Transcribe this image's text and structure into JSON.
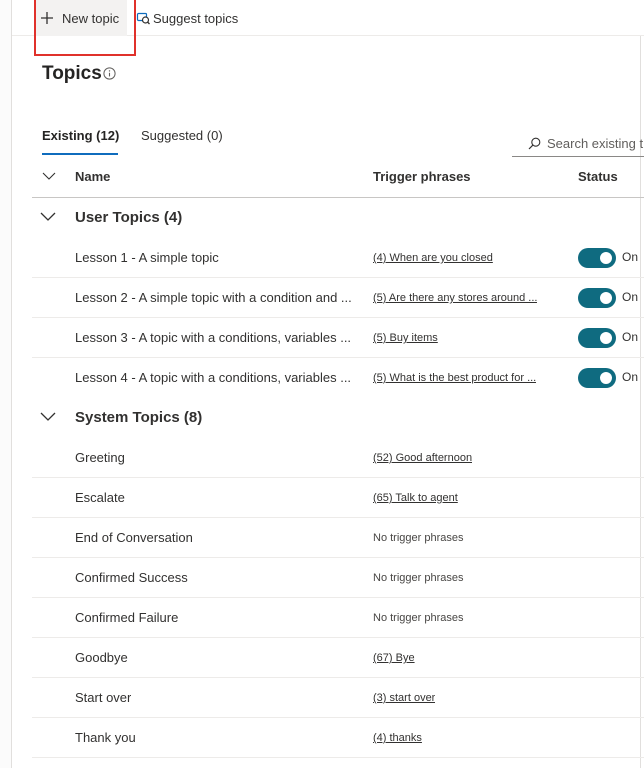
{
  "command_bar": {
    "new_topic": "New topic",
    "suggest_topics": "Suggest topics"
  },
  "page": {
    "title": "Topics"
  },
  "tabs": {
    "existing": "Existing (12)",
    "suggested": "Suggested (0)"
  },
  "search": {
    "placeholder": "Search existing t"
  },
  "table": {
    "col_name": "Name",
    "col_trigger": "Trigger phrases",
    "col_status": "Status"
  },
  "user_topics": {
    "label": "User Topics (4)",
    "rows": [
      {
        "name": "Lesson 1 - A simple topic",
        "trigger": "(4) When are you closed",
        "status": "On"
      },
      {
        "name": "Lesson 2 - A simple topic with a condition and ...",
        "trigger": "(5) Are there any stores around ...",
        "status": "On"
      },
      {
        "name": "Lesson 3 - A topic with a conditions, variables ...",
        "trigger": "(5) Buy items",
        "status": "On"
      },
      {
        "name": "Lesson 4 - A topic with a conditions, variables ...",
        "trigger": "(5) What is the best product for ...",
        "status": "On"
      }
    ]
  },
  "system_topics": {
    "label": "System Topics (8)",
    "rows": [
      {
        "name": "Greeting",
        "trigger": "(52) Good afternoon"
      },
      {
        "name": "Escalate",
        "trigger": "(65) Talk to agent"
      },
      {
        "name": "End of Conversation",
        "trigger": "No trigger phrases"
      },
      {
        "name": "Confirmed Success",
        "trigger": "No trigger phrases"
      },
      {
        "name": "Confirmed Failure",
        "trigger": "No trigger phrases"
      },
      {
        "name": "Goodbye",
        "trigger": "(67) Bye"
      },
      {
        "name": "Start over",
        "trigger": "(3) start over"
      },
      {
        "name": "Thank you",
        "trigger": "(4) thanks"
      }
    ]
  },
  "colors": {
    "accent": "#0f6cbd",
    "toggle_on": "#0f6b80",
    "highlight": "#e0312b"
  }
}
